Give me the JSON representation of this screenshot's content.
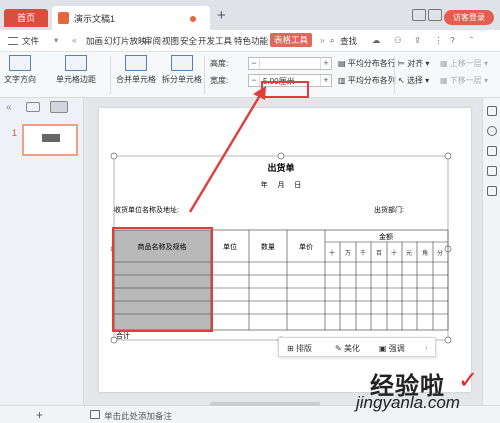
{
  "tabs": {
    "home": "首页",
    "document": "演示文稿1",
    "add": "+"
  },
  "titlebar": {
    "visitor_login": "访客登录"
  },
  "menu": {
    "file": "文件",
    "items": [
      "加画",
      "幻灯片放映",
      "审阅",
      "视图",
      "安全",
      "开发工具",
      "特色功能"
    ],
    "active": "表格工具",
    "search": "查找"
  },
  "ribbon": {
    "text_direction": "文字方向",
    "cell_margin": "单元格边距",
    "merge_cells": "合并单元格",
    "split_cells": "拆分单元格",
    "height_label": "高度:",
    "width_label": "宽度:",
    "height_value": "",
    "width_value": "5.00厘米",
    "dist_rows": "平均分布各行",
    "dist_cols": "平均分布各列",
    "align": "对齐",
    "select": "选择",
    "move_up": "上移一层",
    "move_down": "下移一层"
  },
  "slides_panel": {
    "slide_number": "1",
    "add_slide": "+"
  },
  "invoice": {
    "title": "出货单",
    "date_line": "年     月     日",
    "recipient": "收货单位名称及地址:",
    "dept": "出货部门:",
    "col_product": "商品名称及规格",
    "col_unit": "单位",
    "col_qty": "数量",
    "col_price": "单价",
    "col_amount": "金额",
    "amount_digits": [
      "十",
      "万",
      "千",
      "百",
      "十",
      "元",
      "角",
      "分"
    ],
    "total": "合计"
  },
  "float_bar": {
    "layout": "排版",
    "beautify": "美化",
    "emphasize": "强调"
  },
  "statusbar": {
    "notes_placeholder": "单击此处添加备注"
  },
  "watermark": {
    "text": "经验啦",
    "url": "jingyanla.com"
  },
  "colors": {
    "accent": "#d94f3d",
    "highlight": "#e13d3d",
    "header_cell": "#b9b9b9"
  }
}
